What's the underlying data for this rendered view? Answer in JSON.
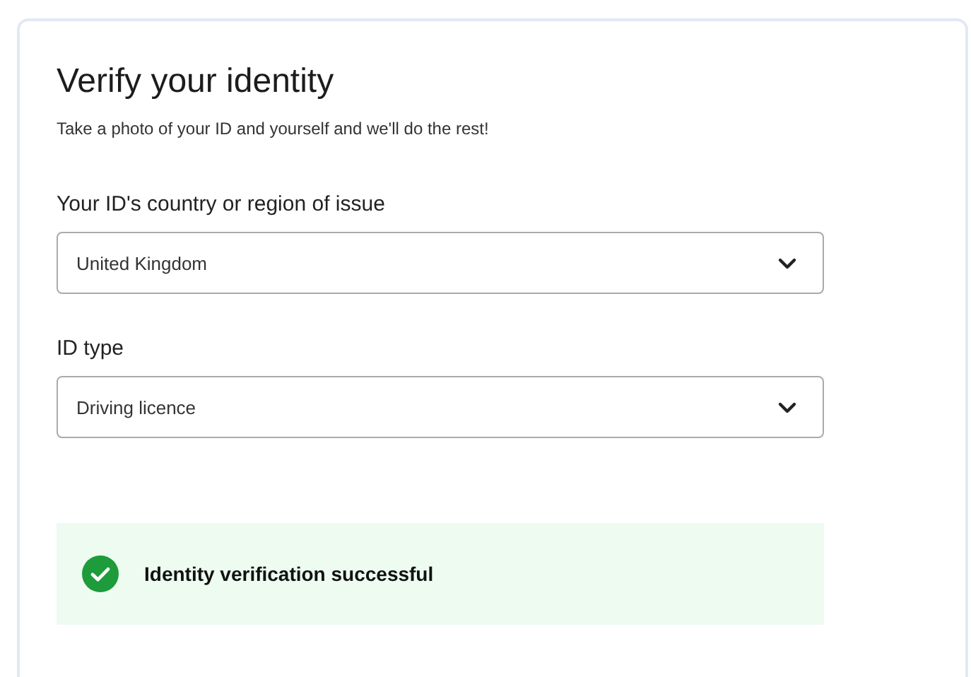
{
  "title": "Verify your identity",
  "subtitle": "Take a photo of your ID and yourself and we'll do the rest!",
  "fields": [
    {
      "label": "Your ID's country or region of issue",
      "value": "United Kingdom"
    },
    {
      "label": "ID type",
      "value": "Driving licence"
    }
  ],
  "status": {
    "kind": "success",
    "message": "Identity verification successful"
  }
}
